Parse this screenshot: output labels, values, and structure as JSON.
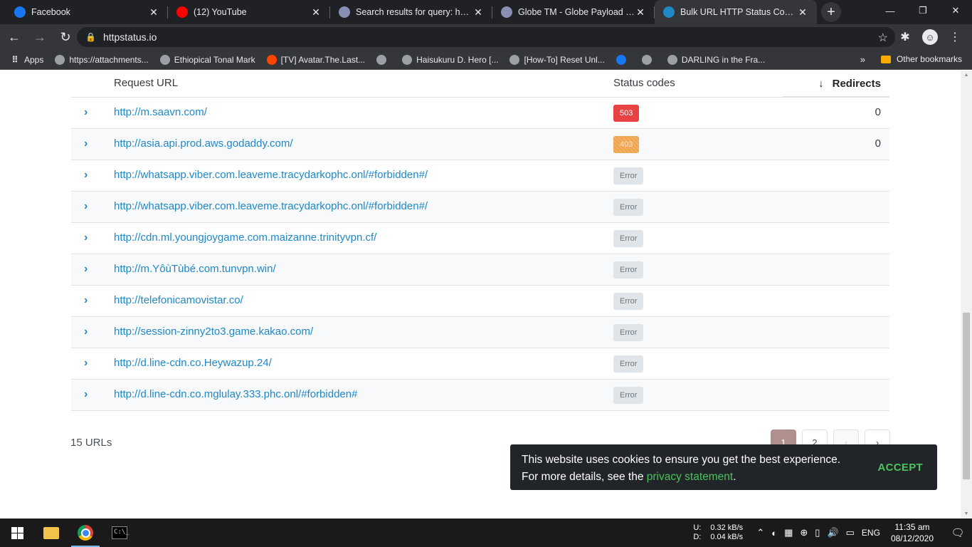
{
  "browser": {
    "tabs": [
      {
        "title": "Facebook",
        "favicon": "facebook-icon",
        "color": "#1877f2",
        "active": false
      },
      {
        "title": "(12) YouTube",
        "favicon": "youtube-icon",
        "color": "#ff0000",
        "active": false
      },
      {
        "title": "Search results for query: hunt p",
        "favicon": "forum-icon",
        "color": "#8a8fb5",
        "active": false
      },
      {
        "title": "Globe TM - Globe Payload [Ho",
        "favicon": "forum-icon",
        "color": "#8a8fb5",
        "active": false
      },
      {
        "title": "Bulk URL HTTP Status Code, He",
        "favicon": "httpstatus-icon",
        "color": "#1e88c8",
        "active": true
      }
    ],
    "address": "httpstatus.io",
    "bookmarks": [
      {
        "label": "Apps",
        "icon": "apps-grid-icon"
      },
      {
        "label": "https://attachments...",
        "icon": "f95-icon"
      },
      {
        "label": "Ethiopical Tonal Mark",
        "icon": "google-icon"
      },
      {
        "label": "[TV] Avatar.The.Last...",
        "icon": "reddit-icon"
      },
      {
        "label": "",
        "icon": "globe-icon"
      },
      {
        "label": "Haisukuru D. Hero [...",
        "icon": "manga-icon"
      },
      {
        "label": "[How-To] Reset Unl...",
        "icon": "globe-icon"
      },
      {
        "label": "",
        "icon": "facebook-icon"
      },
      {
        "label": "",
        "icon": "globe-icon"
      },
      {
        "label": "DARLING in the Fra...",
        "icon": "anime-icon"
      }
    ],
    "bookmarks_more": "»",
    "other_bookmarks": "Other bookmarks"
  },
  "table": {
    "headers": {
      "url": "Request URL",
      "status": "Status codes",
      "redirects": "Redirects"
    },
    "rows": [
      {
        "url": "http://m.saavn.com/",
        "status": "503",
        "kind": "b503",
        "redirects": "0"
      },
      {
        "url": "http://asia.api.prod.aws.godaddy.com/",
        "status": "403",
        "kind": "b403",
        "redirects": "0"
      },
      {
        "url": "http://whatsapp.viber.com.leaveme.tracydarkophc.onl/#forbidden#/",
        "status": "Error",
        "kind": "err",
        "redirects": ""
      },
      {
        "url": "http://whatsapp.viber.com.leaveme.tracydarkophc.onl/#forbidden#/",
        "status": "Error",
        "kind": "err",
        "redirects": ""
      },
      {
        "url": "http://cdn.ml.youngjoygame.com.maizanne.trinityvpn.cf/",
        "status": "Error",
        "kind": "err",
        "redirects": ""
      },
      {
        "url": "http://m.YôùTùbé.com.tunvpn.win/",
        "status": "Error",
        "kind": "err",
        "redirects": ""
      },
      {
        "url": "http://telefonicamovistar.co/",
        "status": "Error",
        "kind": "err",
        "redirects": ""
      },
      {
        "url": "http://session-zinny2to3.game.kakao.com/",
        "status": "Error",
        "kind": "err",
        "redirects": ""
      },
      {
        "url": "http://d.line-cdn.co.Heywazup.24/",
        "status": "Error",
        "kind": "err",
        "redirects": ""
      },
      {
        "url": "http://d.line-cdn.co.mglulay.333.phc.onl/#forbidden#",
        "status": "Error",
        "kind": "err",
        "redirects": ""
      }
    ]
  },
  "summary": {
    "count": "15 URLs"
  },
  "pagination": {
    "pages": [
      "1",
      "2"
    ],
    "current": "1",
    "prev": "‹",
    "next": "›"
  },
  "cookie": {
    "line1": "This website uses cookies to ensure you get the best experience.",
    "line2_prefix": "For more details, see the ",
    "link": "privacy statement",
    "line2_suffix": ".",
    "accept": "ACCEPT"
  },
  "taskbar": {
    "upload_label": "U:",
    "upload": "0.32 kB/s",
    "download_label": "D:",
    "download": "0.04 kB/s",
    "language": "ENG",
    "time": "11:35 am",
    "date": "08/12/2020"
  },
  "colors": {
    "link": "#1e88c8",
    "error_badge": "#dfe5e8",
    "badge_503": "#e84342",
    "badge_403": "#f0a24a",
    "accept": "#4cc25a"
  }
}
